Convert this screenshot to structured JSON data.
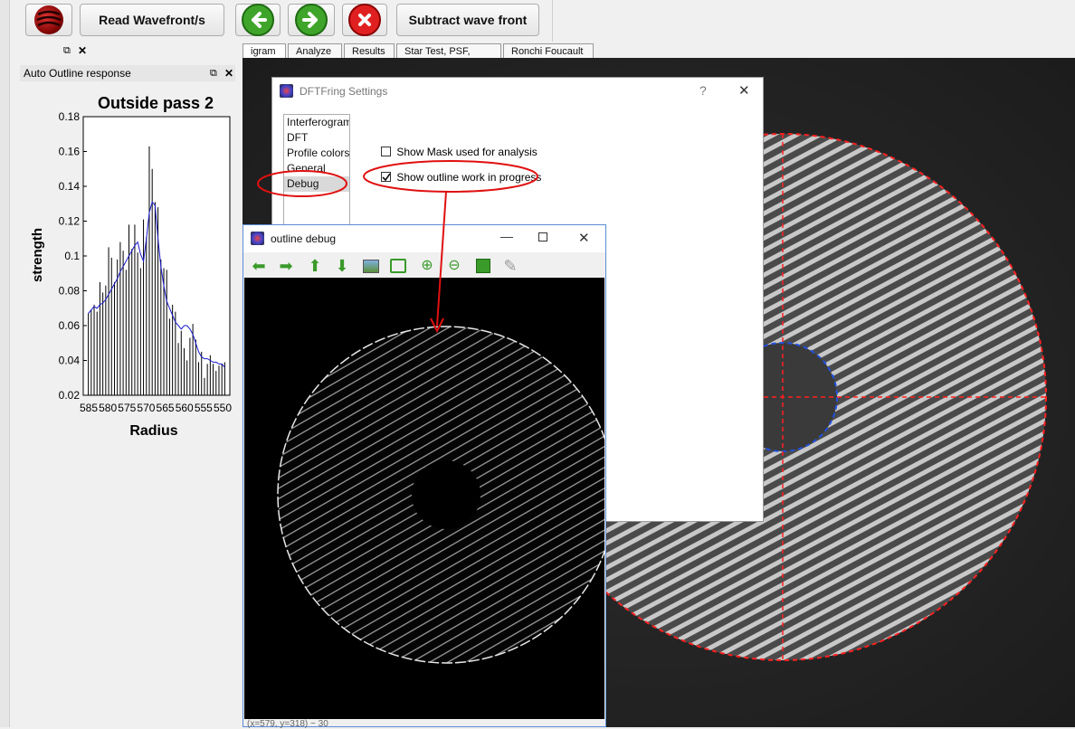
{
  "toolbar": {
    "read_label": "Read Wavefront/s",
    "subtract_label": "Subtract wave front"
  },
  "dock": {
    "title": "Auto Outline response"
  },
  "chart_data": {
    "type": "bar",
    "title": "Outside pass 2",
    "xlabel": "Radius",
    "ylabel": "strength",
    "ylim": [
      0.02,
      0.18
    ],
    "yticks": [
      "0.18",
      "0.16",
      "0.14",
      "0.12",
      "0.1",
      "0.08",
      "0.06",
      "0.04",
      "0.02"
    ],
    "xticks": [
      "585",
      "580",
      "575",
      "570",
      "565",
      "560",
      "555",
      "550"
    ],
    "values": [
      0.067,
      0.069,
      0.072,
      0.068,
      0.085,
      0.079,
      0.083,
      0.105,
      0.099,
      0.085,
      0.098,
      0.108,
      0.103,
      0.092,
      0.118,
      0.104,
      0.118,
      0.102,
      0.093,
      0.121,
      0.111,
      0.163,
      0.15,
      0.131,
      0.128,
      0.098,
      0.093,
      0.092,
      0.064,
      0.072,
      0.068,
      0.05,
      0.057,
      0.047,
      0.04,
      0.053,
      0.061,
      0.052,
      0.039,
      0.045,
      0.03,
      0.038,
      0.043,
      0.038,
      0.034,
      0.037,
      0.038,
      0.039
    ],
    "series": [
      {
        "values": [
          0.067,
          0.069,
          0.071,
          0.07,
          0.072,
          0.073,
          0.075,
          0.078,
          0.081,
          0.084,
          0.087,
          0.091,
          0.094,
          0.097,
          0.1,
          0.103,
          0.106,
          0.108,
          0.101,
          0.097,
          0.11,
          0.125,
          0.131,
          0.129,
          0.11,
          0.094,
          0.083,
          0.074,
          0.07,
          0.066,
          0.062,
          0.06,
          0.058,
          0.06,
          0.06,
          0.058,
          0.055,
          0.05,
          0.045,
          0.042,
          0.041,
          0.041,
          0.04,
          0.039,
          0.039,
          0.038,
          0.038,
          0.036
        ]
      }
    ]
  },
  "tabs": [
    "igram",
    "Analyze",
    "Results",
    "Star Test, PSF, MTF",
    "Ronchi  Foucault"
  ],
  "settings": {
    "title": "DFTFring Settings",
    "help": "?",
    "close": "✕",
    "list": [
      "Interferogram",
      "DFT",
      "Profile colors",
      "General",
      "Debug"
    ],
    "show_mask_label": "Show Mask used for analysis",
    "show_outline_label": "Show outline work in progress",
    "show_mask_checked": false,
    "show_outline_checked": true
  },
  "debug_window": {
    "title": "outline debug",
    "minimize": "—",
    "close": "✕",
    "status": "(x=579, y=318) ~ 30"
  },
  "colors": {
    "annotation_red": "#e01010",
    "outline_red": "#ff2020",
    "obstruction_blue": "#2050e0",
    "line_blue": "#1a1acc"
  }
}
